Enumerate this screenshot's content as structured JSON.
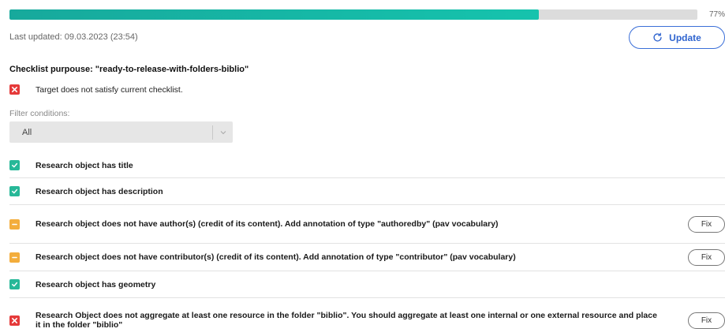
{
  "progress": {
    "percent": 77,
    "label": "77%"
  },
  "last_updated": "Last updated: 09.03.2023 (23:54)",
  "update_button": {
    "label": "Update",
    "icon": "refresh-icon",
    "color": "#2f64cf"
  },
  "checklist_purpose": "Checklist purpouse: \"ready-to-release-with-folders-biblio\"",
  "target_status": {
    "status": "fail",
    "text": "Target does not satisfy current checklist."
  },
  "filter": {
    "label": "Filter conditions:",
    "selected": "All"
  },
  "colors": {
    "pass": "#27b898",
    "warn": "#f3ad3c",
    "fail": "#e53a3a",
    "progress": "#17a99c"
  },
  "checks": [
    {
      "status": "pass",
      "text": "Research object has title",
      "fix": null
    },
    {
      "status": "pass",
      "text": "Research object has description",
      "fix": null
    },
    {
      "status": "warn",
      "text": "Research object does not have author(s) (credit of its content). Add annotation of type \"authoredby\" (pav vocabulary)",
      "fix": "Fix"
    },
    {
      "status": "warn",
      "text": "Research object does not have contributor(s) (credit of its content). Add annotation of type \"contributor\" (pav vocabulary)",
      "fix": "Fix"
    },
    {
      "status": "pass",
      "text": "Research object has geometry",
      "fix": null
    },
    {
      "status": "fail",
      "text": "Research Object does not aggregate at least one resource in the folder \"biblio\". You should aggregate at least one internal or one external resource and place it in the folder \"biblio\"",
      "fix": "Fix"
    }
  ]
}
